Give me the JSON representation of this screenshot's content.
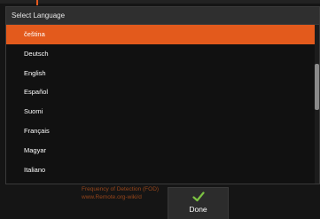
{
  "dialog": {
    "title": "Select Language",
    "selected_index": 0,
    "languages": [
      {
        "label": "čeština"
      },
      {
        "label": "Deutsch"
      },
      {
        "label": "English"
      },
      {
        "label": "Español"
      },
      {
        "label": "Suomi"
      },
      {
        "label": "Français"
      },
      {
        "label": "Magyar"
      },
      {
        "label": "Italiano"
      }
    ]
  },
  "background": {
    "text_line_1": "Frequency of Detection (FOD)",
    "text_line_2": "www.Remote.org-wiki/d"
  },
  "done_button": {
    "label": "Done",
    "icon": "check-icon"
  },
  "colors": {
    "accent": "#e35a1c",
    "check": "#7cc242",
    "header_bg": "#2f2f2f",
    "list_bg": "#111111"
  }
}
